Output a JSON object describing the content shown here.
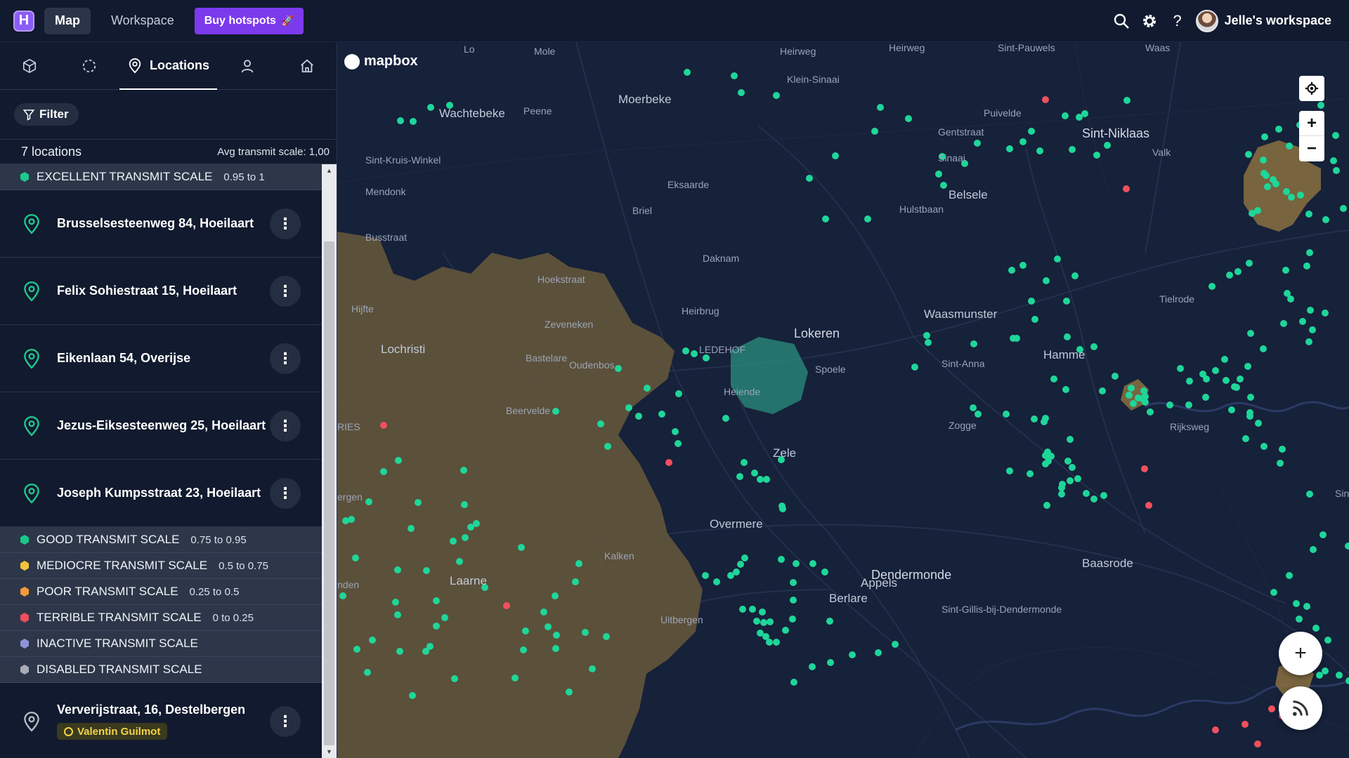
{
  "topbar": {
    "logo_letter": "H",
    "nav": [
      "Map",
      "Workspace"
    ],
    "buy_label": "Buy hotspots",
    "workspace_label": "Jelle's workspace"
  },
  "sidebar": {
    "tabs": [
      {
        "icon": "cube-icon",
        "label": ""
      },
      {
        "icon": "dashed-circle-icon",
        "label": ""
      },
      {
        "icon": "map-pin-icon",
        "label": "Locations"
      },
      {
        "icon": "user-icon",
        "label": ""
      },
      {
        "icon": "home-icon",
        "label": ""
      }
    ],
    "filter_label": "Filter",
    "count_label": "7 locations",
    "avg_label": "Avg transmit scale: 1,00",
    "groups": [
      {
        "name": "EXCELLENT TRANSMIT SCALE",
        "range": "0.95 to 1",
        "color": "#1fc98e"
      },
      {
        "name": "GOOD TRANSMIT SCALE",
        "range": "0.75 to 0.95",
        "color": "#17c98a"
      },
      {
        "name": "MEDIOCRE TRANSMIT SCALE",
        "range": "0.5 to 0.75",
        "color": "#f3c53a"
      },
      {
        "name": "POOR TRANSMIT SCALE",
        "range": "0.25 to 0.5",
        "color": "#f39a3a"
      },
      {
        "name": "TERRIBLE TRANSMIT SCALE",
        "range": "0 to 0.25",
        "color": "#ef4f5d"
      },
      {
        "name": "INACTIVE TRANSMIT SCALE",
        "range": "",
        "color": "#8f93d8"
      },
      {
        "name": "DISABLED TRANSMIT SCALE",
        "range": "",
        "color": "#a9acb4"
      }
    ],
    "excellent_locations": [
      "Brusselsesteenweg 84, Hoeilaart",
      "Felix Sohiestraat 15, Hoeilaart",
      "Eikenlaan 54, Overijse",
      "Jezus-Eiksesteenweg 25, Hoeilaart",
      "Joseph Kumpsstraat 23, Hoeilaart"
    ],
    "extra_location": {
      "name": "Ververijstraat, 16, Destelbergen",
      "owner": "Valentin Guilmot"
    }
  },
  "map": {
    "attribution": "mapbox",
    "places": [
      {
        "name": "Moerbeke",
        "cls": "big"
      },
      {
        "name": "Wachtebeke",
        "cls": "big"
      },
      {
        "name": "Peene",
        "cls": ""
      },
      {
        "name": "Klein-Sinaai",
        "cls": ""
      },
      {
        "name": "Puivelde",
        "cls": ""
      },
      {
        "name": "Sint-Niklaas",
        "cls": "city"
      },
      {
        "name": "Sint-Pauwels",
        "cls": ""
      },
      {
        "name": "Waas",
        "cls": ""
      },
      {
        "name": "Sint-Kruis-Winkel",
        "cls": ""
      },
      {
        "name": "Mendonk",
        "cls": ""
      },
      {
        "name": "Eksaarde",
        "cls": ""
      },
      {
        "name": "Sinaai",
        "cls": ""
      },
      {
        "name": "Belsele",
        "cls": "big"
      },
      {
        "name": "Valk",
        "cls": ""
      },
      {
        "name": "Briel",
        "cls": ""
      },
      {
        "name": "Daknam",
        "cls": ""
      },
      {
        "name": "Lokeren",
        "cls": "city"
      },
      {
        "name": "Hijfte",
        "cls": ""
      },
      {
        "name": "Lochristi",
        "cls": "big"
      },
      {
        "name": "Zeveneken",
        "cls": ""
      },
      {
        "name": "Bastelare",
        "cls": ""
      },
      {
        "name": "Oudenbos",
        "cls": ""
      },
      {
        "name": "Waasmunster",
        "cls": "big"
      },
      {
        "name": "Hamme",
        "cls": "big"
      },
      {
        "name": "Tielrode",
        "cls": ""
      },
      {
        "name": "Sint-Anna",
        "cls": ""
      },
      {
        "name": "Spoele",
        "cls": ""
      },
      {
        "name": "Heiende",
        "cls": ""
      },
      {
        "name": "Beervelde",
        "cls": ""
      },
      {
        "name": "Zogge",
        "cls": ""
      },
      {
        "name": "Zele",
        "cls": "big"
      },
      {
        "name": "Overmere",
        "cls": "big"
      },
      {
        "name": "Kalken",
        "cls": ""
      },
      {
        "name": "Appels",
        "cls": "big"
      },
      {
        "name": "Dendermonde",
        "cls": "city"
      },
      {
        "name": "Baasrode",
        "cls": "big"
      },
      {
        "name": "Berlare",
        "cls": "big"
      },
      {
        "name": "Laarne",
        "cls": "big"
      },
      {
        "name": "Sint-Gillis-bij-Dendermonde",
        "cls": ""
      },
      {
        "name": "Heirweg",
        "cls": ""
      },
      {
        "name": "Hulstbaan",
        "cls": ""
      },
      {
        "name": "Hoekstraat",
        "cls": ""
      },
      {
        "name": "Busstraat",
        "cls": ""
      },
      {
        "name": "Rijksweg",
        "cls": ""
      },
      {
        "name": "Heirweg",
        "cls": ""
      },
      {
        "name": "Heirbrug",
        "cls": ""
      },
      {
        "name": "LEDEHOF",
        "cls": ""
      },
      {
        "name": "Gentstraat",
        "cls": ""
      },
      {
        "name": "Lo",
        "cls": ""
      },
      {
        "name": "Mole",
        "cls": ""
      },
      {
        "name": "ergen",
        "cls": ""
      },
      {
        "name": "RIES",
        "cls": ""
      },
      {
        "name": "nden",
        "cls": ""
      },
      {
        "name": "Sint",
        "cls": ""
      },
      {
        "name": "Uitbergen",
        "cls": ""
      }
    ]
  }
}
